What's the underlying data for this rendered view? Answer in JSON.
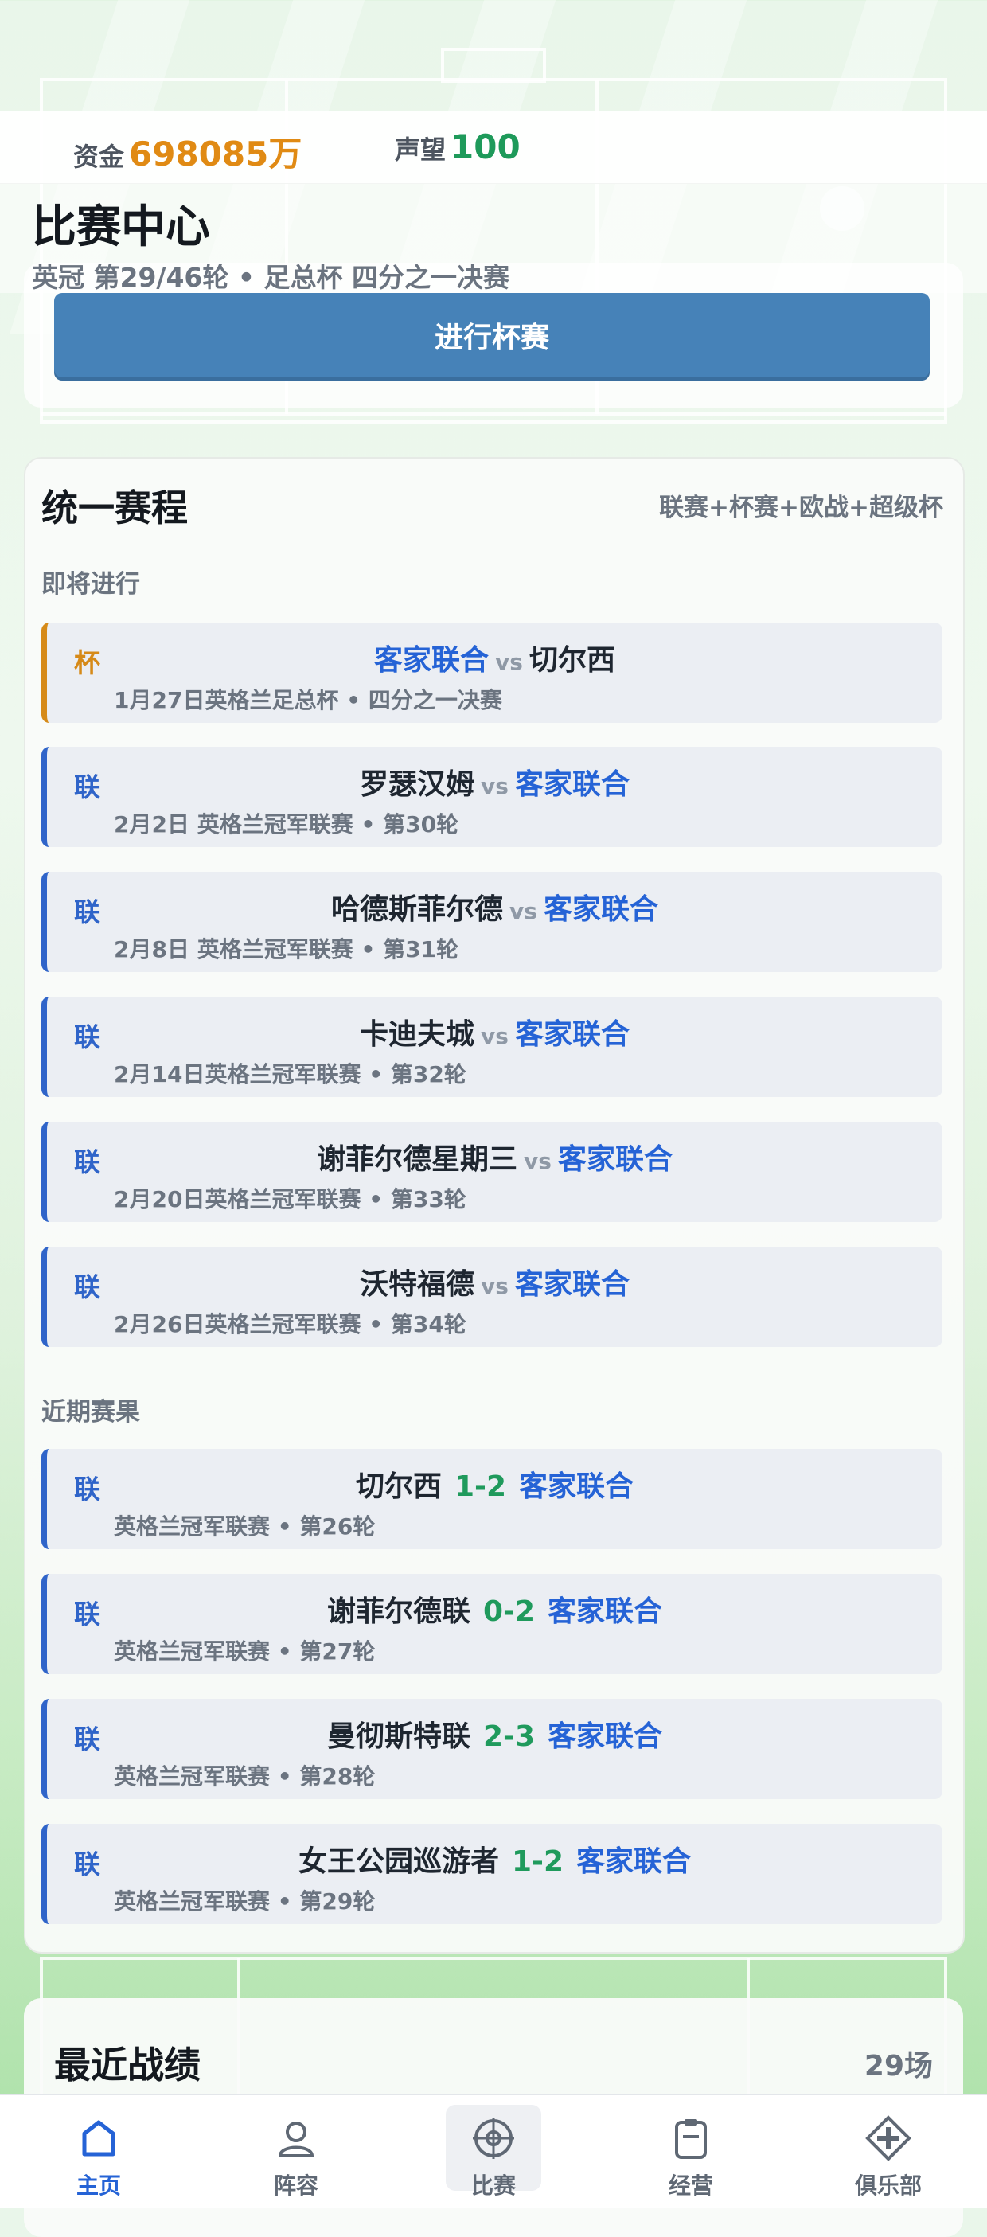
{
  "resources": {
    "money_label": "资金",
    "money_value": "698085万",
    "fame_label": "声望",
    "fame_value": "100"
  },
  "header": {
    "title": "比赛中心",
    "subtitle": "英冠 第29/46轮 • 足总杯 四分之一决赛"
  },
  "cup_button": {
    "label": "进行杯赛"
  },
  "schedule": {
    "title": "统一赛程",
    "tag": "联赛+杯赛+欧战+超级杯",
    "upcoming_label": "即将进行",
    "upcoming": [
      {
        "type": "杯",
        "home": "客家联合",
        "vs": "vs",
        "away": "切尔西",
        "info": "1月27日英格兰足总杯 • 四分之一决赛",
        "home_is_club": true
      },
      {
        "type": "联",
        "home": "罗瑟汉姆",
        "vs": "vs",
        "away": "客家联合",
        "info": "2月2日  英格兰冠军联赛 • 第30轮",
        "home_is_club": false
      },
      {
        "type": "联",
        "home": "哈德斯菲尔德",
        "vs": "vs",
        "away": "客家联合",
        "info": "2月8日  英格兰冠军联赛 • 第31轮",
        "home_is_club": false
      },
      {
        "type": "联",
        "home": "卡迪夫城",
        "vs": "vs",
        "away": "客家联合",
        "info": "2月14日英格兰冠军联赛 • 第32轮",
        "home_is_club": false
      },
      {
        "type": "联",
        "home": "谢菲尔德星期三",
        "vs": "vs",
        "away": "客家联合",
        "info": "2月20日英格兰冠军联赛 • 第33轮",
        "home_is_club": false
      },
      {
        "type": "联",
        "home": "沃特福德",
        "vs": "vs",
        "away": "客家联合",
        "info": "2月26日英格兰冠军联赛 • 第34轮",
        "home_is_club": false
      }
    ],
    "results_label": "近期赛果",
    "results": [
      {
        "type": "联",
        "home": "切尔西",
        "score": "1-2",
        "away": "客家联合",
        "info": "英格兰冠军联赛 • 第26轮"
      },
      {
        "type": "联",
        "home": "谢菲尔德联",
        "score": "0-2",
        "away": "客家联合",
        "info": "英格兰冠军联赛 • 第27轮"
      },
      {
        "type": "联",
        "home": "曼彻斯特联",
        "score": "2-3",
        "away": "客家联合",
        "info": "英格兰冠军联赛 • 第28轮"
      },
      {
        "type": "联",
        "home": "女王公园巡游者",
        "score": "1-2",
        "away": "客家联合",
        "info": "英格兰冠军联赛 • 第29轮"
      }
    ]
  },
  "recent_form": {
    "title": "最近战绩",
    "count": "29场"
  },
  "nav": [
    {
      "label": "主页",
      "icon": "home-icon",
      "active": true
    },
    {
      "label": "阵容",
      "icon": "user-icon",
      "active": false
    },
    {
      "label": "比赛",
      "icon": "match-target-icon",
      "active": false
    },
    {
      "label": "经营",
      "icon": "clipboard-icon",
      "active": false
    },
    {
      "label": "俱乐部",
      "icon": "club-cross-icon",
      "active": false
    }
  ],
  "colors": {
    "club_blue": "#2563d6",
    "score_green": "#1f9a5c",
    "cup_orange": "#d68a18",
    "button_blue": "#4682b8",
    "money_orange": "#e08a14"
  }
}
